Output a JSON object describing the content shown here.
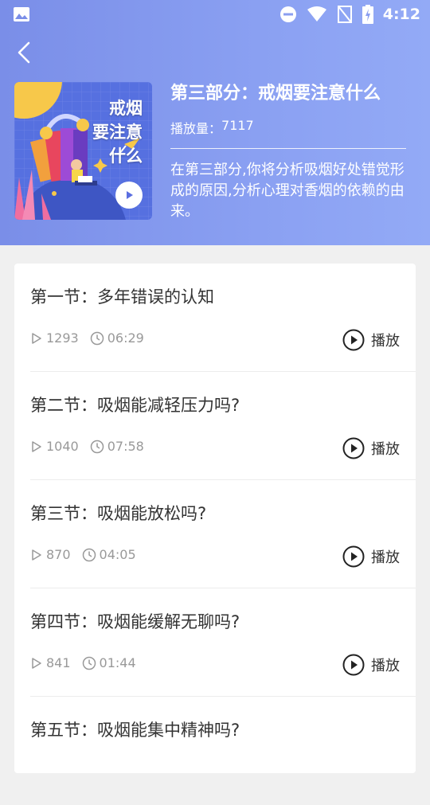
{
  "status_bar": {
    "time": "4:12",
    "icons": [
      "image-icon",
      "dnd-icon",
      "wifi-icon",
      "no-sim-icon",
      "battery-charging-icon"
    ]
  },
  "header": {
    "cover_title_lines": [
      "戒烟",
      "要注意",
      "什么"
    ],
    "title": "第三部分：戒烟要注意什么",
    "plays_label": "播放量：",
    "plays_value": "7117",
    "description": "在第三部分,你将分析吸烟好处错觉形成的原因,分析心理对香烟的依赖的由来。"
  },
  "lessons": [
    {
      "title": "第一节：多年错误的认知",
      "plays": "1293",
      "duration": "06:29",
      "action": "播放"
    },
    {
      "title": "第二节：吸烟能减轻压力吗?",
      "plays": "1040",
      "duration": "07:58",
      "action": "播放"
    },
    {
      "title": "第三节：吸烟能放松吗?",
      "plays": "870",
      "duration": "04:05",
      "action": "播放"
    },
    {
      "title": "第四节：吸烟能缓解无聊吗?",
      "plays": "841",
      "duration": "01:44",
      "action": "播放"
    },
    {
      "title": "第五节：吸烟能集中精神吗?",
      "plays": "",
      "duration": "",
      "action": ""
    }
  ],
  "colors": {
    "header_start": "#7a8ee8",
    "header_end": "#93aaf6",
    "text_dark": "#333333",
    "text_meta": "#999999"
  }
}
